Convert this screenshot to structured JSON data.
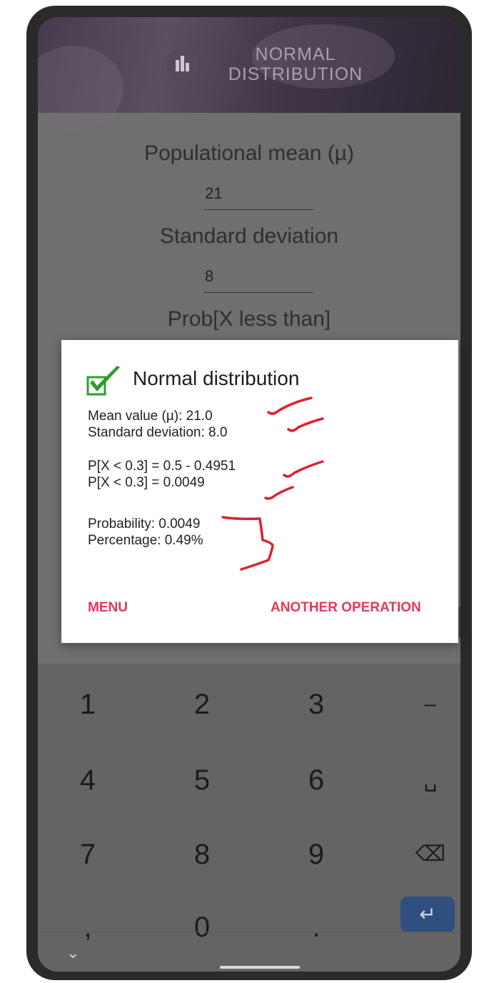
{
  "header": {
    "title_line1": "NORMAL",
    "title_line2": "DISTRIBUTION",
    "icon": "bar-chart-icon"
  },
  "form": {
    "mean_label": "Populational mean (µ)",
    "mean_value": "21",
    "sd_label": "Standard deviation",
    "sd_value": "8",
    "prob_label": "Prob[X less than]"
  },
  "dialog": {
    "title": "Normal distribution",
    "icon": "check-icon",
    "mean_line": "Mean value (µ): 21.0",
    "sd_line": "Standard deviation: 8.0",
    "p_line1": "P[X < 0.3] = 0.5 - 0.4951",
    "p_line2": "P[X < 0.3] = 0.0049",
    "probability_line": "Probability: 0.0049",
    "percentage_line": "Percentage: 0.49%",
    "menu_button": "MENU",
    "another_button": "ANOTHER OPERATION",
    "accent_color": "#e8375a",
    "check_color": "#2e9e2e"
  },
  "keyboard": {
    "row1": [
      "1",
      "2",
      "3",
      "–"
    ],
    "row2": [
      "4",
      "5",
      "6",
      "␣"
    ],
    "row3": [
      "7",
      "8",
      "9",
      "⌫"
    ],
    "row4": [
      ",",
      "0",
      ".",
      "↵"
    ],
    "hide_icon": "chevron-down-icon"
  },
  "annotations": {
    "color": "#e0202e",
    "kind": "handwritten checkmarks and bracket"
  }
}
